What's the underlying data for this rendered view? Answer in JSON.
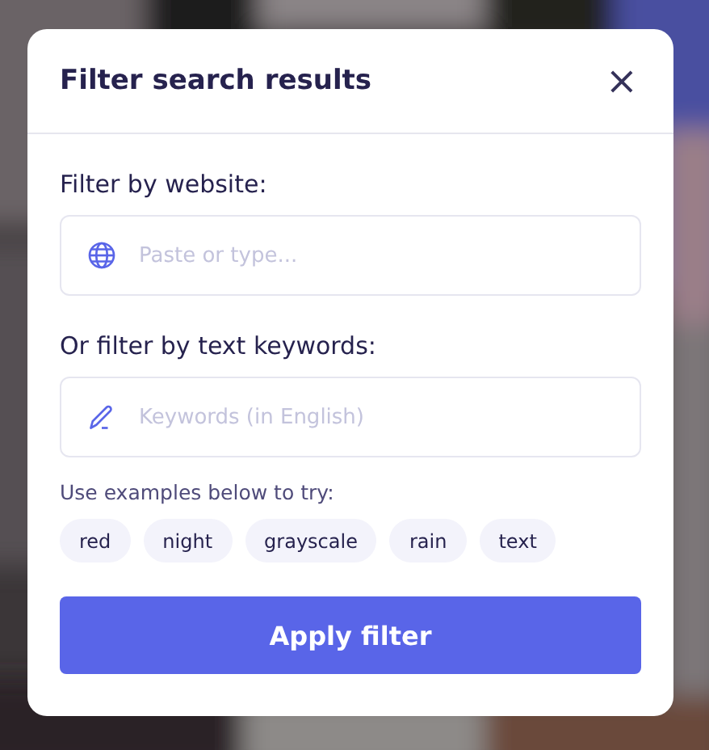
{
  "dialog": {
    "title": "Filter search results",
    "close": "×"
  },
  "website_filter": {
    "label": "Filter by website:",
    "placeholder": "Paste or type..."
  },
  "keyword_filter": {
    "label": "Or filter by text keywords:",
    "placeholder": "Keywords (in English)"
  },
  "examples": {
    "hint": "Use examples below to try:",
    "tags": [
      "red",
      "night",
      "grayscale",
      "rain",
      "text"
    ]
  },
  "apply_button": "Apply filter"
}
